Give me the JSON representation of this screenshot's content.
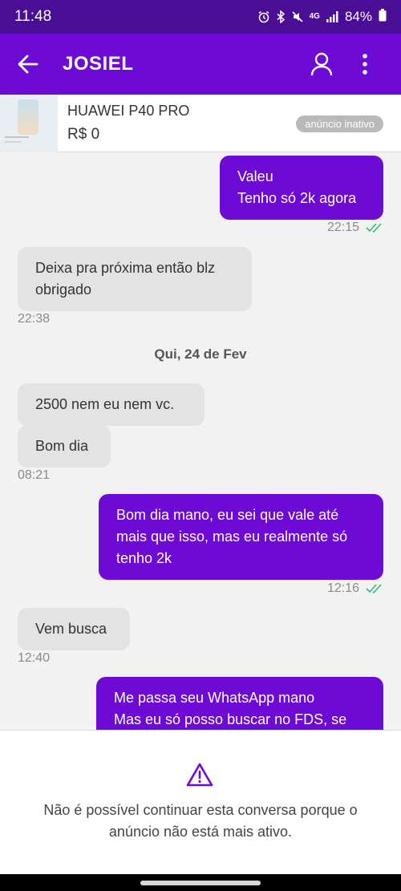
{
  "status_bar": {
    "time": "11:48",
    "network": "4G",
    "battery": "84%"
  },
  "header": {
    "contact_name": "JOSIEL"
  },
  "ad": {
    "title": "HUAWEI P40 PRO",
    "price": "R$ 0",
    "status": "anúncio inativo"
  },
  "messages": [
    {
      "direction": "out",
      "lines": [
        "Valeu",
        "Tenho só 2k agora"
      ],
      "time": "22:15",
      "read": true
    },
    {
      "direction": "in",
      "lines": [
        "Deixa pra próxima então blz",
        "obrigado"
      ],
      "time": "22:38"
    },
    {
      "direction": "in",
      "lines": [
        "2500 nem eu nem vc."
      ]
    },
    {
      "direction": "in",
      "lines": [
        "Bom dia"
      ],
      "time": "08:21"
    },
    {
      "direction": "out",
      "lines": [
        "Bom dia mano, eu sei que vale até",
        "mais que isso, mas eu realmente só",
        "tenho 2k"
      ],
      "time": "12:16",
      "read": true
    },
    {
      "direction": "in",
      "lines": [
        "Vem busca"
      ],
      "time": "12:40"
    },
    {
      "direction": "out",
      "lines": [
        "Me passa seu WhatsApp mano",
        "Mas eu só posso buscar no FDS, se"
      ]
    }
  ],
  "date_separator": "Qui, 24 de Fev",
  "notice": {
    "icon": "warning-icon",
    "text": "Não é possível continuar esta conversa porque o anúncio não está mais ativo."
  },
  "colors": {
    "primary": "#6e0ad6",
    "status_bar": "#4a0d95",
    "incoming_bubble": "#e3e3e3",
    "read_check": "#2fbf71"
  }
}
